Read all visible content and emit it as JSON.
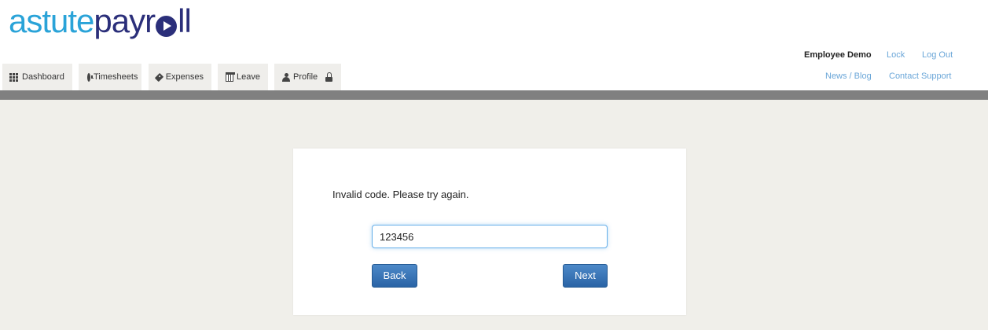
{
  "logo": {
    "part1": "astute",
    "part2": "payr",
    "part3": "ll"
  },
  "nav": {
    "tabs": [
      {
        "label": "Dashboard",
        "icon": "grid-icon"
      },
      {
        "label": "Timesheets",
        "icon": "clock-icon"
      },
      {
        "label": "Expenses",
        "icon": "tag-icon"
      },
      {
        "label": "Leave",
        "icon": "calendar-icon"
      },
      {
        "label": "Profile",
        "icon": "user-icon",
        "extra_icon": "lock-icon"
      }
    ]
  },
  "user_links": {
    "name": "Employee Demo",
    "lock": "Lock",
    "logout": "Log Out",
    "news": "News / Blog",
    "support": "Contact Support"
  },
  "form": {
    "message": "Invalid code. Please try again.",
    "code_value": "123456",
    "back_label": "Back",
    "next_label": "Next"
  },
  "colors": {
    "brand_light": "#2aa3d8",
    "brand_dark": "#2b2f7a",
    "link": "#6aa6d8",
    "button": "#2a64a6",
    "bar": "#808080",
    "background": "#f0efea"
  }
}
